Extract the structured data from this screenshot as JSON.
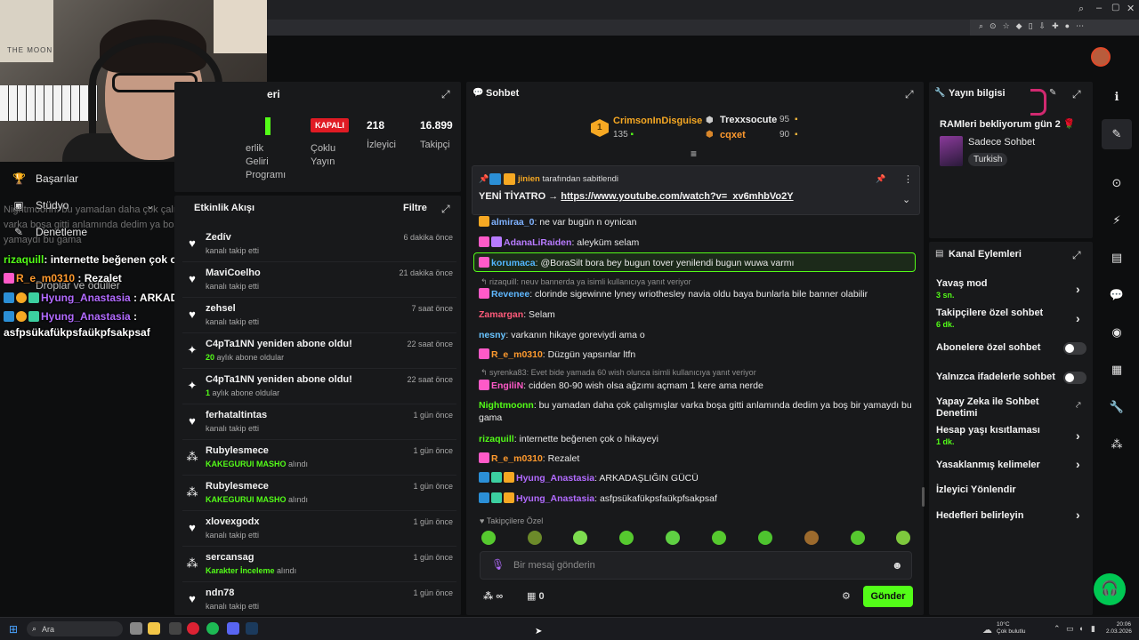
{
  "left_nav": {
    "items": [
      {
        "label": "Başarılar",
        "icon": "trophy-icon"
      },
      {
        "label": "Stüdyo",
        "icon": "studio-icon"
      },
      {
        "label": "Denetleme",
        "icon": "wrench-icon"
      },
      {
        "label": "Droplar ve ödüller",
        "icon": "gift-icon"
      }
    ],
    "overlay_partial_1": "Nightmoonn: bu yamadan daha çok çalışmışlar",
    "overlay_partial_2": "varka boşa gitti anlamında dedim ya boş bir",
    "overlay_partial_3": "yamaydı bu gama",
    "overlay": [
      {
        "user": "rizaquill",
        "text": "internette beğenen çok o hikayeyi"
      },
      {
        "user": "R_e_m0310",
        "text": "Rezalet"
      },
      {
        "user": "Hyung_Anastasia",
        "text": "ARKADAŞLIĞIN GÜCÜ"
      },
      {
        "user": "Hyung_Anastasia",
        "text": "asfpsükafükpsfaükpfsakpsaf"
      }
    ]
  },
  "stats": {
    "title": "eri",
    "ortaklik": "Ortaklık",
    "ortaklik_lines": [
      "erlik",
      "Geliri",
      "Programı"
    ],
    "status_badge": "KAPALI",
    "status_label_1": "Çoklu",
    "status_label_2": "Yayın",
    "viewers_value": "218",
    "viewers_label": "İzleyici",
    "followers_value": "16.899",
    "followers_label": "Takipçi"
  },
  "activity": {
    "title": "Etkinlik Akışı",
    "filter": "Filtre",
    "items": [
      {
        "icon": "heart-icon",
        "name": "Zedív",
        "sub": "kanalı takip etti",
        "time": "6 dakika önce"
      },
      {
        "icon": "heart-icon",
        "name": "MaviCoelho",
        "sub": "kanalı takip etti",
        "time": "21 dakika önce"
      },
      {
        "icon": "heart-icon",
        "name": "zehsel",
        "sub": "kanalı takip etti",
        "time": "7 saat önce"
      },
      {
        "icon": "sparkle-icon",
        "name": "C4pTa1NN yeniden abone oldu!",
        "sub_hl": "20",
        "sub": " aylık abone oldular",
        "time": "22 saat önce"
      },
      {
        "icon": "sparkle-icon",
        "name": "C4pTa1NN yeniden abone oldu!",
        "sub_hl": "1",
        "sub": " aylık abone oldular",
        "time": "22 saat önce"
      },
      {
        "icon": "heart-icon",
        "name": "ferhataltintas",
        "sub": "kanalı takip etti",
        "time": "1 gün önce"
      },
      {
        "icon": "reward-icon",
        "name": "Rubylesmece",
        "sub_hl": "KAKEGURUI MASHO",
        "sub": " alındı",
        "time": "1 gün önce"
      },
      {
        "icon": "reward-icon",
        "name": "Rubylesmece",
        "sub_hl": "KAKEGURUI MASHO",
        "sub": " alındı",
        "time": "1 gün önce"
      },
      {
        "icon": "heart-icon",
        "name": "xlovexgodx",
        "sub": "kanalı takip etti",
        "time": "1 gün önce"
      },
      {
        "icon": "reward-icon",
        "name": "sercansag",
        "sub_hl": "Karakter İnceleme",
        "sub": " alındı",
        "time": "1 gün önce"
      },
      {
        "icon": "heart-icon",
        "name": "ndn78",
        "sub": "kanalı takip etti",
        "time": "1 gün önce"
      }
    ]
  },
  "chat": {
    "title": "Sohbet",
    "top_gifters": [
      {
        "rank": "1",
        "name": "CrimsonInDisguise",
        "amount": "135"
      },
      {
        "rank": "2",
        "name": "Trexxsocute",
        "amount": "95"
      },
      {
        "rank": "3",
        "name": "cqxet",
        "amount": "90"
      }
    ],
    "pinned": {
      "user": "jinien",
      "by": "tarafından sabitlendi",
      "text": "YENİ TİYATRO → ",
      "link": "https://www.youtube.com/watch?v=_xv6mhbVo2Y"
    },
    "messages": [
      {
        "user": "almiraa_0",
        "color": "#7fb2ff",
        "text": ": ne var bugün n oynican"
      },
      {
        "user": "AdanaLiRaiden",
        "color": "#b87bff",
        "text": ": aleyküm selam"
      },
      {
        "user": "korumaca",
        "color": "#53b7ff",
        "text": ": @BoraSilt bora bey bugun tover yenilendi bugun wuwa varmı"
      },
      {
        "user": "Revenee",
        "color": "#5fb8ff",
        "text": ": clorinde sigewinne lyney wriothesley navia oldu baya bunlarla bile banner olabilir"
      },
      {
        "user": "Zamargan",
        "color": "#ff5a7a",
        "text": ": Selam"
      },
      {
        "user": "nesny",
        "color": "#69c4ff",
        "text": ": varkanın hikaye goreviydi ama o"
      },
      {
        "user": "R_e_m0310",
        "color": "#ff9a2e",
        "text": ": Düzgün yapsınlar ltfn"
      },
      {
        "user": "EngiliN",
        "color": "#ff5ac8",
        "text": ": cidden 80-90 wish olsa ağzımı açmam 1 kere ama nerde"
      },
      {
        "user": "Nightmoonn",
        "color": "#53fc18",
        "text": ": bu yamadan daha çok çalışmışlar varka boşa gitti anlamında dedim ya boş bir yamaydı bu gama"
      },
      {
        "user": "rizaquill",
        "color": "#53fc18",
        "text": ": internette beğenen çok o hikayeyi"
      },
      {
        "user": "R_e_m0310",
        "color": "#ff9a2e",
        "text": ": Rezalet"
      },
      {
        "user": "Hyung_Anastasia",
        "color": "#b26bff",
        "text": ": ARKADAŞLIĞIN GÜCÜ"
      },
      {
        "user": "Hyung_Anastasia",
        "color": "#b26bff",
        "text": ": asfpsükafükpsfaükpfsakpsaf"
      }
    ],
    "reply_1": "rizaquill: neuv bannerda ya isimli kullanıcıya yanıt veriyor",
    "reply_2": "syrenka83: Evet bide yamada 60 wish olunca isimli kullanıcıya yanıt veriyor",
    "emote_section": "Takipçilere Özel",
    "input_placeholder": "Bir mesaj gönderin",
    "points": "∞",
    "shop_count": "0",
    "send": "Gönder"
  },
  "stream_info": {
    "title": "Yayın bilgisi",
    "stream_title": "RAMleri bekliyorum gün 2",
    "category": "Sadece Sohbet",
    "tag": "Turkish"
  },
  "channel_actions": {
    "title": "Kanal Eylemleri",
    "items": [
      {
        "label": "Yavaş mod",
        "sub": "3 sn.",
        "ctrl": "chevron"
      },
      {
        "label": "Takipçilere özel sohbet",
        "sub": "6 dk.",
        "ctrl": "chevron"
      },
      {
        "label": "Abonelere özel sohbet",
        "sub": "",
        "ctrl": "toggle"
      },
      {
        "label": "Yalnızca ifadelerle sohbet",
        "sub": "",
        "ctrl": "toggle"
      },
      {
        "label": "Yapay Zeka ile Sohbet Denetimi",
        "sub": "",
        "ctrl": "external"
      },
      {
        "label": "Hesap yaşı kısıtlaması",
        "sub": "1 dk.",
        "ctrl": "chevron"
      },
      {
        "label": "Yasaklanmış kelimeler",
        "sub": "",
        "ctrl": "chevron"
      },
      {
        "label": "İzleyici Yönlendir",
        "sub": "",
        "ctrl": "none"
      },
      {
        "label": "Hedefleri belirleyin",
        "sub": "",
        "ctrl": "chevron"
      }
    ]
  },
  "taskbar": {
    "search": "Ara",
    "weather_temp": "10°C",
    "weather_desc": "Çok bulutlu",
    "time": "20:06",
    "date": "2.03.2026"
  }
}
